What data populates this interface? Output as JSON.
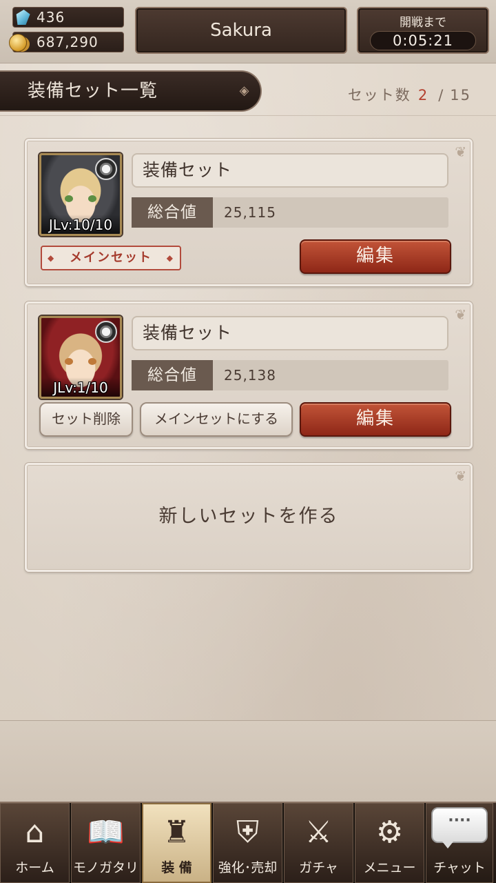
{
  "header": {
    "gems": "436",
    "coins": "687,290",
    "player_name": "Sakura",
    "timer_label": "開戦まで",
    "timer_value": "0:05:21"
  },
  "title": {
    "text": "装備セット一覧",
    "ornament": "◈",
    "count_label": "セット数",
    "count_current": "2",
    "count_separator": "/",
    "count_max": "15"
  },
  "sets": [
    {
      "name": "装備セット",
      "stat_label": "総合値",
      "stat_value": "25,115",
      "level": "JLv:10/10",
      "main_badge": "メインセット",
      "edit_label": "編集"
    },
    {
      "name": "装備セット",
      "stat_label": "総合値",
      "stat_value": "25,138",
      "level": "JLv:1/10",
      "delete_label": "セット削除",
      "make_main_label": "メインセットにする",
      "edit_label": "編集"
    }
  ],
  "new_set": {
    "label": "新しいセットを作る"
  },
  "nav": {
    "items": [
      {
        "label": "ホーム",
        "icon": "home-icon",
        "glyph": "⌂"
      },
      {
        "label": "モノガタリ",
        "icon": "book-icon",
        "glyph": "📖"
      },
      {
        "label": "装 備",
        "icon": "puppet-icon",
        "glyph": "♜",
        "active": true
      },
      {
        "label": "強化･売却",
        "icon": "enhance-icon",
        "glyph": "⛨"
      },
      {
        "label": "ガチャ",
        "icon": "swords-icon",
        "glyph": "⚔"
      },
      {
        "label": "メニュー",
        "icon": "gears-icon",
        "glyph": "⚙"
      }
    ],
    "chat": {
      "label": "チャット",
      "bubble": "····"
    }
  },
  "colors": {
    "accent_red": "#a53b2d",
    "edit_button": "#b0432c",
    "dark_panel": "#34261f"
  }
}
